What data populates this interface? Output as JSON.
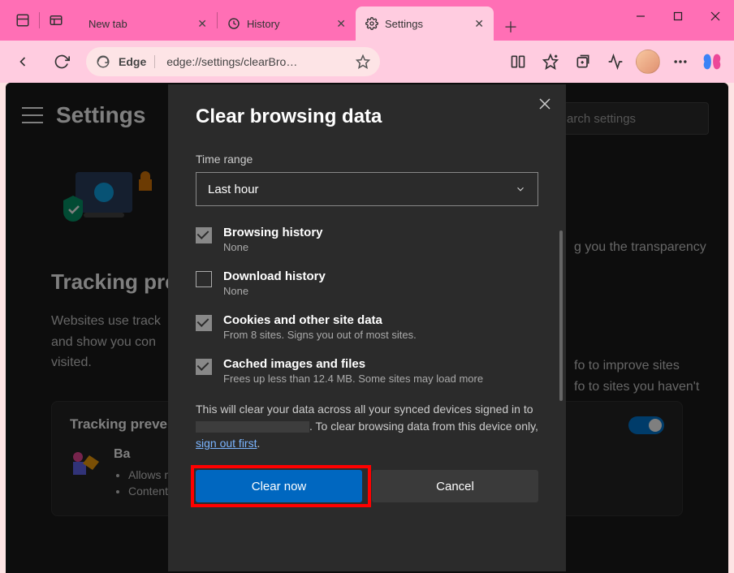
{
  "browser": {
    "tabs": [
      {
        "label": "New tab",
        "icon": "tab-icon"
      },
      {
        "label": "History",
        "icon": "history-icon"
      },
      {
        "label": "Settings",
        "icon": "gear-icon",
        "active": true
      }
    ],
    "toolbar": {
      "edge_label": "Edge",
      "url": "edge://settings/clearBro…"
    }
  },
  "settings": {
    "title": "Settings",
    "search_placeholder": "arch settings",
    "bg_text1": "g you the transparency",
    "bg_text2": "fo to improve sites",
    "bg_text3": "fo to sites you haven't",
    "tracking_heading": "Tracking pre",
    "tracking_desc1": "Websites use track",
    "tracking_desc2": "and show you con",
    "tracking_desc3": "visited.",
    "card_title": "Tracking preve",
    "basic_label": "Ba",
    "bullet1": "Allows mos",
    "bullet2": "Content an"
  },
  "modal": {
    "title": "Clear browsing data",
    "time_range_label": "Time range",
    "time_range_value": "Last hour",
    "options": [
      {
        "title": "Browsing history",
        "desc": "None",
        "checked": true
      },
      {
        "title": "Download history",
        "desc": "None",
        "checked": false
      },
      {
        "title": "Cookies and other site data",
        "desc": "From 8 sites. Signs you out of most sites.",
        "checked": true
      },
      {
        "title": "Cached images and files",
        "desc": "Frees up less than 12.4 MB. Some sites may load more",
        "checked": true
      }
    ],
    "sync_note_1": "This will clear your data across all your synced devices signed in to ",
    "sync_note_2": ". To clear browsing data from this device only, ",
    "sync_link": "sign out first",
    "clear_btn": "Clear now",
    "cancel_btn": "Cancel"
  }
}
